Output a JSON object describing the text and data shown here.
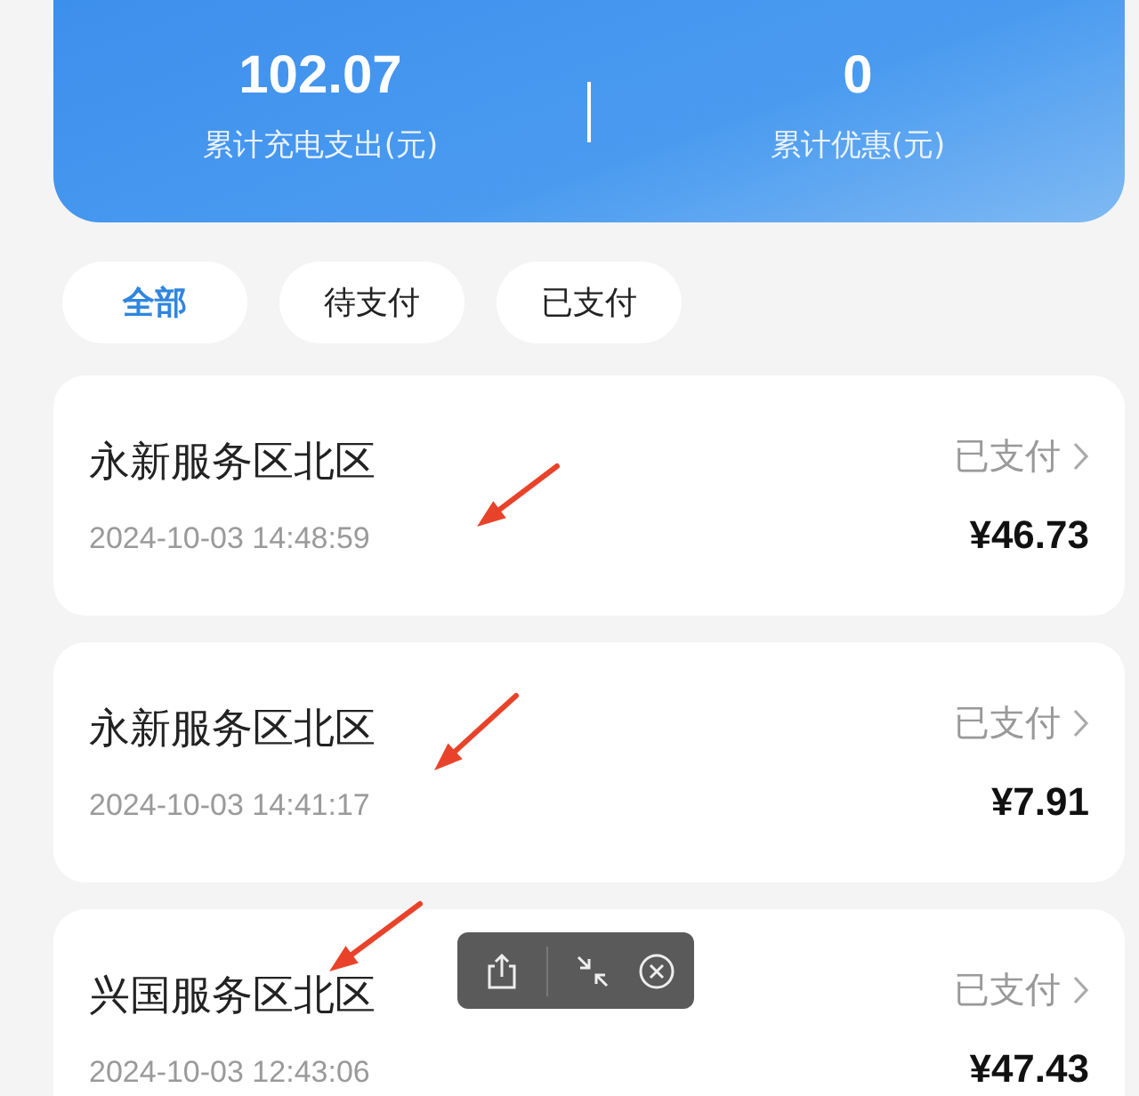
{
  "summary": {
    "stats": [
      {
        "value": "102.07",
        "label": "累计充电支出(元)"
      },
      {
        "value": "0",
        "label": "累计优惠(元)"
      }
    ]
  },
  "filters": [
    {
      "label": "全部",
      "selected": true
    },
    {
      "label": "待支付",
      "selected": false
    },
    {
      "label": "已支付",
      "selected": false
    }
  ],
  "records": [
    {
      "station": "永新服务区北区",
      "time": "2024-10-03 14:48:59",
      "status": "已支付",
      "amount": "¥46.73"
    },
    {
      "station": "永新服务区北区",
      "time": "2024-10-03 14:41:17",
      "status": "已支付",
      "amount": "¥7.91"
    },
    {
      "station": "兴国服务区北区",
      "time": "2024-10-03 12:43:06",
      "status": "已支付",
      "amount": "¥47.43"
    }
  ]
}
